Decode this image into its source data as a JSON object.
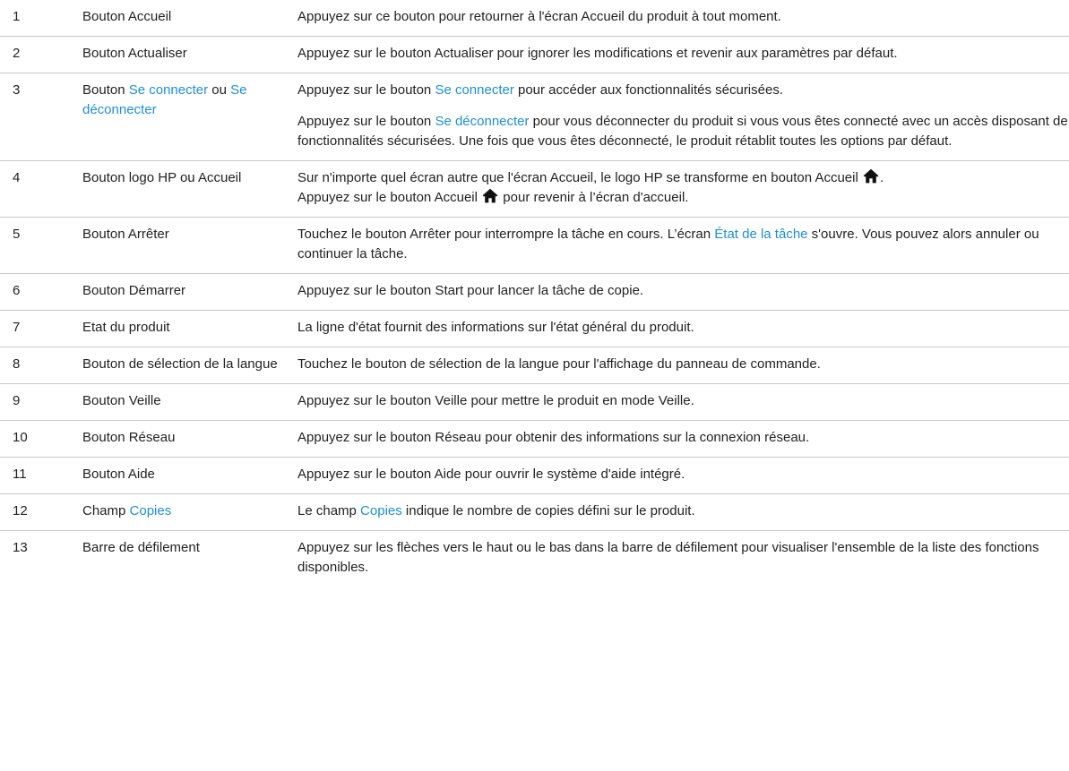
{
  "colors": {
    "text": "#222222",
    "link": "#1f8fd6",
    "divider": "#c8c8c8"
  },
  "rows": [
    {
      "num": "1",
      "name": [
        {
          "t": "Bouton Accueil"
        }
      ],
      "desc": [
        [
          {
            "t": "Appuyez sur ce bouton pour retourner à l'écran Accueil du produit à tout moment."
          }
        ]
      ]
    },
    {
      "num": "2",
      "name": [
        {
          "t": "Bouton Actualiser"
        }
      ],
      "desc": [
        [
          {
            "t": "Appuyez sur le bouton Actualiser pour ignorer les modifications et revenir aux paramètres par défaut."
          }
        ]
      ]
    },
    {
      "num": "3",
      "name": [
        {
          "t": "Bouton "
        },
        {
          "t": "Se connecter",
          "link": true
        },
        {
          "t": " ou "
        },
        {
          "t": "Se déconnecter",
          "link": true
        }
      ],
      "desc": [
        [
          {
            "t": "Appuyez sur le bouton "
          },
          {
            "t": "Se connecter",
            "link": true
          },
          {
            "t": " pour accéder aux fonctionnalités sécurisées."
          }
        ],
        [
          {
            "t": "Appuyez sur le bouton "
          },
          {
            "t": "Se déconnecter",
            "link": true
          },
          {
            "t": " pour vous déconnecter du produit si vous vous êtes connecté avec un accès disposant de fonctionnalités sécurisées. Une fois que vous êtes déconnecté, le produit rétablit toutes les options par défaut."
          }
        ]
      ]
    },
    {
      "num": "4",
      "name": [
        {
          "t": "Bouton logo HP ou Accueil"
        }
      ],
      "desc": [
        [
          {
            "t": "Sur n'importe quel écran autre que l'écran Accueil, le logo HP se transforme en bouton Accueil "
          },
          {
            "icon": "home-icon"
          },
          {
            "t": "."
          },
          {
            "br": true
          },
          {
            "t": "Appuyez sur le bouton Accueil "
          },
          {
            "icon": "home-icon"
          },
          {
            "t": " pour revenir à l’écran d'accueil."
          }
        ]
      ]
    },
    {
      "num": "5",
      "name": [
        {
          "t": "Bouton Arrêter"
        }
      ],
      "desc": [
        [
          {
            "t": "Touchez le bouton Arrêter pour interrompre la tâche en cours. L’écran "
          },
          {
            "t": "État de la tâche",
            "link": true
          },
          {
            "t": " s'ouvre. Vous pouvez alors annuler ou continuer la tâche."
          }
        ]
      ]
    },
    {
      "num": "6",
      "name": [
        {
          "t": "Bouton Démarrer"
        }
      ],
      "desc": [
        [
          {
            "t": "Appuyez sur le bouton Start pour lancer la tâche de copie."
          }
        ]
      ]
    },
    {
      "num": "7",
      "name": [
        {
          "t": "Etat du produit"
        }
      ],
      "desc": [
        [
          {
            "t": "La ligne d'état fournit des informations sur l'état général du produit."
          }
        ]
      ]
    },
    {
      "num": "8",
      "name": [
        {
          "t": "Bouton de sélection de la langue"
        }
      ],
      "desc": [
        [
          {
            "t": "Touchez le bouton de sélection de la langue pour l'affichage du panneau de commande."
          }
        ]
      ]
    },
    {
      "num": "9",
      "name": [
        {
          "t": "Bouton Veille"
        }
      ],
      "desc": [
        [
          {
            "t": "Appuyez sur le bouton Veille pour mettre le produit en mode Veille."
          }
        ]
      ]
    },
    {
      "num": "10",
      "name": [
        {
          "t": "Bouton Réseau"
        }
      ],
      "desc": [
        [
          {
            "t": "Appuyez sur le bouton Réseau pour obtenir des informations sur la connexion réseau."
          }
        ]
      ]
    },
    {
      "num": "11",
      "name": [
        {
          "t": "Bouton Aide"
        }
      ],
      "desc": [
        [
          {
            "t": "Appuyez sur le bouton Aide pour ouvrir le système d'aide intégré."
          }
        ]
      ]
    },
    {
      "num": "12",
      "name": [
        {
          "t": "Champ "
        },
        {
          "t": "Copies",
          "link": true
        }
      ],
      "desc": [
        [
          {
            "t": "Le champ "
          },
          {
            "t": "Copies",
            "link": true
          },
          {
            "t": " indique le nombre de copies défini sur le produit."
          }
        ]
      ]
    },
    {
      "num": "13",
      "name": [
        {
          "t": "Barre de défilement"
        }
      ],
      "desc": [
        [
          {
            "t": "Appuyez sur les flèches vers le haut ou le bas dans la barre de défilement pour visualiser l'ensemble de la liste des fonctions disponibles."
          }
        ]
      ]
    }
  ]
}
